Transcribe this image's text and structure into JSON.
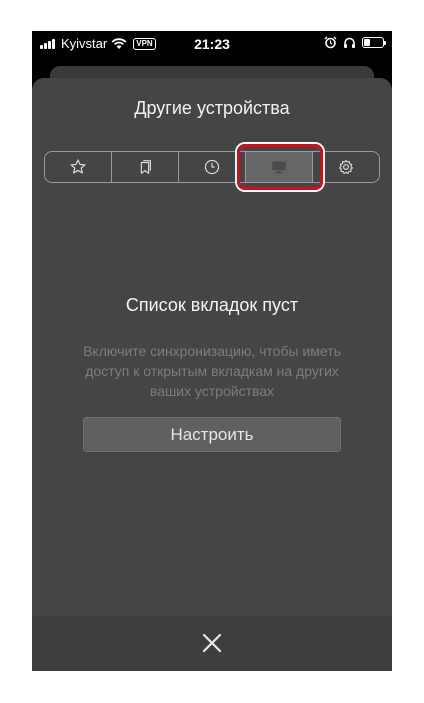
{
  "status_bar": {
    "carrier": "Kyivstar",
    "vpn": "VPN",
    "time": "21:23",
    "battery_level": 0.35
  },
  "sheet": {
    "title": "Другие устройства",
    "tabs": [
      {
        "icon": "star-icon",
        "label": "Bookmarks",
        "active": false
      },
      {
        "icon": "reading-list-icon",
        "label": "Reading list",
        "active": false
      },
      {
        "icon": "clock-icon",
        "label": "History",
        "active": false
      },
      {
        "icon": "monitor-icon",
        "label": "Other devices",
        "active": true
      },
      {
        "icon": "gear-icon",
        "label": "Settings",
        "active": false
      }
    ],
    "empty_title": "Список вкладок пуст",
    "empty_description": "Включите синхронизацию, чтобы иметь доступ к открытым вкладкам на других ваших устройствах",
    "setup_button": "Настроить",
    "close_icon": "close-icon"
  },
  "colors": {
    "sheet_background": "#454545",
    "highlight": "#d10f1a",
    "button_background": "#606060"
  }
}
